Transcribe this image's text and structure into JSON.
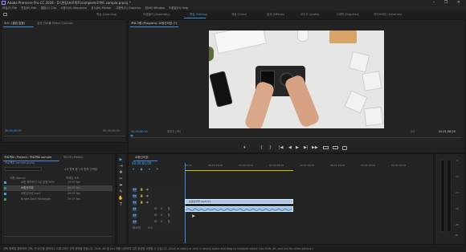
{
  "titlebar": {
    "text": "Adobe Premiere Pro CC 2018 - D:\\편집\\프로젝트\\sample프로젝트 sample.prproj *",
    "controls": "– ❐ ✕"
  },
  "menu": [
    "파일(F) File",
    "편집(E) Edit",
    "클립(C) Clip",
    "시퀀스(S) Sequence",
    "표식(M) Marker",
    "그래픽(G) Graphics",
    "창(W) Window",
    "도움말(H) Help"
  ],
  "workspaces": [
    "학습 (Learning)",
    "어셈블리 (Assembly)",
    "편집 (Editing)",
    "색상 (Color)",
    "효과 (Effects)",
    "오디오 (Audio)",
    "그래픽 (Graphics)",
    "라이브러리 (Libraries)"
  ],
  "source_panel": {
    "tab1": "소스: (클립 없음)",
    "tab2": "효과 컨트롤 Effect Controls",
    "timecode_left": "00;00;00;00",
    "timecode_right": "00;00;00;00"
  },
  "program_panel": {
    "tab": "프로그램 (Program): 쇼핑신이었 (?)",
    "timecode": "00;00;00;00",
    "fit": "맞추기 (Fit)",
    "ratio": "1/2",
    "duration": "00;01;08;28"
  },
  "project_panel": {
    "tab1": "프로젝트 (Project): 프로젝트 sample",
    "tab2": "미디어 (Media)",
    "filename": "프로젝트 sample.prproj",
    "search_placeholder": "",
    "selection": "4개 항목 중 1개 항목 선택됨",
    "col_name": "이름 (Name)",
    "col_fps": "프레임 속도",
    "items": [
      {
        "name": "쇼핑 좋아하신 1분 분량.MP4",
        "fps": "29.97 fps",
        "color": "#4b9be0"
      },
      {
        "name": "쇼핑신이었",
        "fps": "29.97 fps",
        "color": "#2f9a5a"
      },
      {
        "name": "쇼핑신이었.mp4",
        "fps": "29.97 fps",
        "color": "#4b9be0"
      },
      {
        "name": "Bright Dark Rectangle",
        "fps": "29.97 fps",
        "color": "#2f9a5a"
      }
    ]
  },
  "timeline": {
    "tab": "쇼핑신이었",
    "timecode": "00;00;00;00",
    "ruler": [
      "00;00",
      "00;00;16;00",
      "00;00;32;00",
      "00;00;48;00",
      "00;01;04;00",
      "00;01;20;00",
      "00;01;36;00",
      "00;01;52;00"
    ],
    "video_tracks": [
      "V3",
      "V2",
      "V1"
    ],
    "audio_tracks": [
      "A1",
      "A2",
      "A3"
    ],
    "master": "마스터",
    "master_value": "0.0",
    "video_clip_label": "쇼핑신이었.mp4 [V]",
    "status": "선택 항목을 클릭하여 선택, 빈 공간을 클릭하고 드래그하여 선택 윤곽을 만듭니다. Shift, Alt 및 Ctrl 키를 사용하여 다른 옵션을 사용할 수 있습니다. (Click to select or click in empty space and drag to marquee select. Use Shift, Alt, and Ctrl for other options.)"
  },
  "tools": [
    "▶",
    "⇥",
    "✥",
    "✂",
    "⬌",
    "✎",
    "✋",
    "T"
  ],
  "transport": [
    "▾",
    "{",
    "}",
    "|◀",
    "◀",
    "▶",
    "▶|",
    "▶▶"
  ],
  "meter_labels": [
    "0",
    "-12",
    "-24",
    "-36",
    "-48",
    "dB"
  ],
  "colors": {
    "accent": "#3f8ae0",
    "clip_video": "#a7c7e8",
    "clip_audio": "#99c3ea"
  }
}
